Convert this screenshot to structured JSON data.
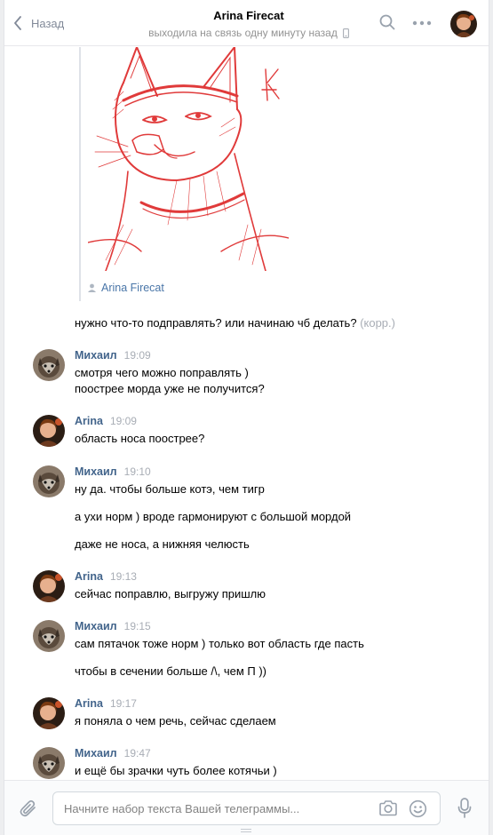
{
  "header": {
    "back_label": "Назад",
    "title": "Arina Firecat",
    "status": "выходила на связь одну минуту назад"
  },
  "attachment": {
    "author": "Arina Firecat"
  },
  "standalone_line": {
    "text": "нужно что-то подправлять? или начинаю чб делать?",
    "edited": "(корр.)"
  },
  "messages": [
    {
      "author": "Михаил",
      "time": "19:09",
      "lines": [
        "смотря чего можно поправлять )",
        "поострее морда уже не получится?"
      ]
    },
    {
      "author": "Arina",
      "time": "19:09",
      "lines": [
        "область носа поострее?"
      ]
    },
    {
      "author": "Михаил",
      "time": "19:10",
      "lines": [
        "ну да. чтобы больше котэ, чем тигр",
        "а ухи норм ) вроде гармонируют с большой мордой",
        "даже не носа, а нижняя челюсть"
      ]
    },
    {
      "author": "Arina",
      "time": "19:13",
      "lines": [
        "сейчас поправлю, выгружу пришлю"
      ]
    },
    {
      "author": "Михаил",
      "time": "19:15",
      "lines": [
        "сам пятачок тоже норм ) только вот область где пасть",
        "чтобы в сечении больше /\\, чем П ))"
      ]
    },
    {
      "author": "Arina",
      "time": "19:17",
      "lines": [
        "я поняла о чем речь, сейчас сделаем"
      ]
    },
    {
      "author": "Михаил",
      "time": "19:47",
      "lines": [
        "и ещё бы зрачки чуть более котячьи )"
      ]
    }
  ],
  "composer": {
    "placeholder": "Начните набор текста Вашей телеграммы..."
  }
}
